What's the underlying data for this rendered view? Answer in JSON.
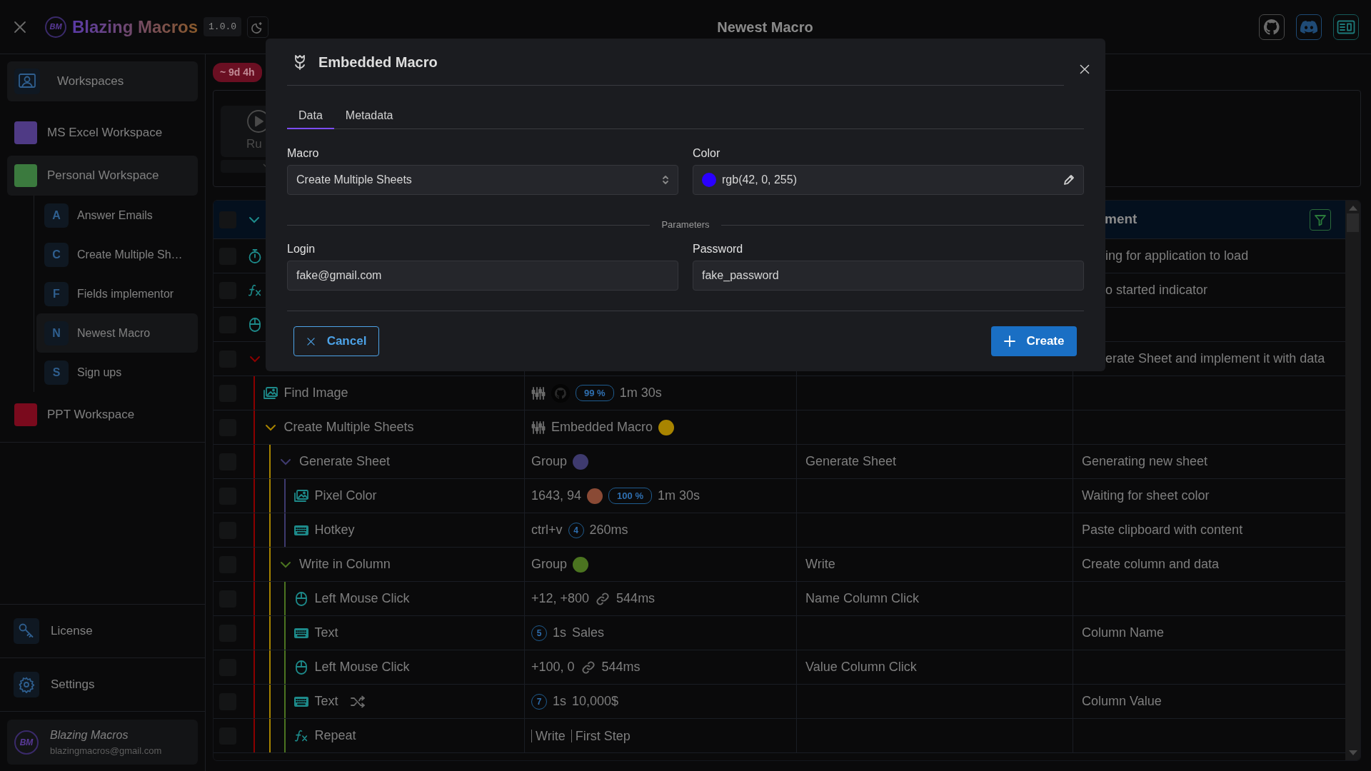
{
  "header": {
    "logo_text": "BM",
    "app_name": "Blazing Macros",
    "version": "1.0.0",
    "title": "Newest Macro"
  },
  "sidebar": {
    "workspaces_label": "Workspaces",
    "workspaces": [
      {
        "name": "MS Excel Workspace",
        "color": "#4f3a85",
        "selected": false
      },
      {
        "name": "Personal Workspace",
        "color": "#3b7a3e",
        "selected": true,
        "macros": [
          {
            "letter": "A",
            "name": "Answer Emails",
            "selected": false
          },
          {
            "letter": "C",
            "name": "Create Multiple Sh…",
            "selected": false
          },
          {
            "letter": "F",
            "name": "Fields implementor",
            "selected": false
          },
          {
            "letter": "N",
            "name": "Newest Macro",
            "selected": true
          },
          {
            "letter": "S",
            "name": "Sign ups",
            "selected": false
          }
        ]
      },
      {
        "name": "PPT Workspace",
        "color": "#7a0a1d",
        "selected": false
      }
    ],
    "license_label": "License",
    "settings_label": "Settings",
    "profile": {
      "avatar_text": "BM",
      "name": "Blazing Macros",
      "email": "blazingmacros@gmail.com"
    }
  },
  "main": {
    "timer_badge": "~ 9d 4h",
    "run_label": "Ru"
  },
  "table": {
    "header": {
      "checked": false,
      "expanded": true,
      "column_5": "ment"
    },
    "rows": [
      {
        "kind": "timer",
        "checked": false,
        "randomized": false,
        "column_5": "ing for application to load"
      },
      {
        "kind": "function",
        "checked": false,
        "randomized": false,
        "column_5": "o started indicator"
      },
      {
        "kind": "mouse",
        "checked": false,
        "randomized": false
      },
      {
        "kind": "group",
        "checked": false,
        "randomized": false,
        "expanded": true,
        "color": "#8b0000",
        "column_5": "erate Sheet and implement it with data",
        "children": [
          {
            "kind": "image",
            "name": "Find Image",
            "checked": false,
            "randomized": false,
            "params": [
              {
                "kind": "sliders"
              },
              {
                "kind": "avatar"
              },
              {
                "kind": "percent",
                "text": "99 %"
              },
              {
                "kind": "text",
                "text": "1m 30s"
              }
            ]
          },
          {
            "kind": "embedded",
            "name": "Create Multiple Sheets",
            "checked": false,
            "randomized": false,
            "expanded": true,
            "color": "#a88400",
            "params": [
              {
                "kind": "sliders"
              },
              {
                "kind": "text",
                "text": "Embedded Macro"
              },
              {
                "kind": "dot",
                "color": "#a88400"
              }
            ],
            "children": [
              {
                "kind": "group",
                "name": "Generate Sheet",
                "checked": false,
                "randomized": false,
                "expanded": true,
                "color": "#3e3a6e",
                "params": [
                  {
                    "kind": "text",
                    "text": "Group"
                  },
                  {
                    "kind": "dot",
                    "color": "#3e3a6e"
                  }
                ],
                "column_4": "Generate Sheet",
                "column_5": "Generating new sheet",
                "children": [
                  {
                    "kind": "image",
                    "name": "Pixel Color",
                    "checked": false,
                    "randomized": false,
                    "params": [
                      {
                        "kind": "text",
                        "text": "1643, 94"
                      },
                      {
                        "kind": "dot",
                        "color": "#8a4a35"
                      },
                      {
                        "kind": "percent",
                        "text": "100 %"
                      },
                      {
                        "kind": "text",
                        "text": "1m 30s"
                      }
                    ],
                    "column_5": "Waiting for sheet color"
                  },
                  {
                    "kind": "keyboard",
                    "name": "Hotkey",
                    "checked": false,
                    "randomized": false,
                    "params": [
                      {
                        "kind": "text",
                        "text": "ctrl+v"
                      },
                      {
                        "kind": "count",
                        "text": "4"
                      },
                      {
                        "kind": "text",
                        "text": "260ms"
                      }
                    ],
                    "column_5": "Paste clipboard with content"
                  }
                ]
              },
              {
                "kind": "group",
                "name": "Write in Column",
                "checked": false,
                "randomized": false,
                "expanded": true,
                "color": "#4b7420",
                "params": [
                  {
                    "kind": "text",
                    "text": "Group"
                  },
                  {
                    "kind": "dot",
                    "color": "#4b7420"
                  }
                ],
                "column_4": "Write",
                "column_5": "Create column and data",
                "children": [
                  {
                    "kind": "mouse",
                    "name": "Left Mouse Click",
                    "checked": false,
                    "randomized": false,
                    "params": [
                      {
                        "kind": "text",
                        "text": "+12, +800"
                      },
                      {
                        "kind": "link"
                      },
                      {
                        "kind": "text",
                        "text": "544ms"
                      }
                    ],
                    "column_4": "Name Column Click"
                  },
                  {
                    "kind": "keyboard",
                    "name": "Text",
                    "checked": false,
                    "randomized": false,
                    "params": [
                      {
                        "kind": "count",
                        "text": "5"
                      },
                      {
                        "kind": "text",
                        "text": "1s"
                      },
                      {
                        "kind": "text",
                        "text": "Sales"
                      }
                    ],
                    "column_5": "Column Name"
                  },
                  {
                    "kind": "mouse",
                    "name": "Left Mouse Click",
                    "checked": false,
                    "randomized": false,
                    "params": [
                      {
                        "kind": "text",
                        "text": "+100, 0"
                      },
                      {
                        "kind": "link"
                      },
                      {
                        "kind": "text",
                        "text": "544ms"
                      }
                    ],
                    "column_4": "Value Column Click"
                  },
                  {
                    "kind": "keyboard",
                    "name": "Text",
                    "checked": false,
                    "randomized": true,
                    "params": [
                      {
                        "kind": "count",
                        "text": "7"
                      },
                      {
                        "kind": "text",
                        "text": "1s"
                      },
                      {
                        "kind": "text",
                        "text": "10,000$"
                      }
                    ],
                    "column_5": "Column Value"
                  },
                  {
                    "kind": "function",
                    "name": "Repeat",
                    "checked": false,
                    "randomized": false,
                    "params": [
                      {
                        "kind": "ref",
                        "text": "Write"
                      },
                      {
                        "kind": "ref",
                        "text": "First Step"
                      }
                    ]
                  }
                ]
              }
            ]
          }
        ]
      }
    ]
  },
  "modal": {
    "title": "Embedded Macro",
    "tabs": [
      {
        "label": "Data",
        "selected": true
      },
      {
        "label": "Metadata",
        "selected": false
      }
    ],
    "macro": {
      "label": "Macro",
      "value": "Create Multiple Sheets"
    },
    "color": {
      "label": "Color",
      "value": "rgb(42, 0, 255)",
      "color": "#2a00ff"
    },
    "section": "Parameters",
    "params": [
      {
        "label": "Login",
        "value": "fake@gmail.com"
      },
      {
        "label": "Password",
        "value": "fake_password"
      }
    ],
    "cancel": "Cancel",
    "create": "Create"
  }
}
